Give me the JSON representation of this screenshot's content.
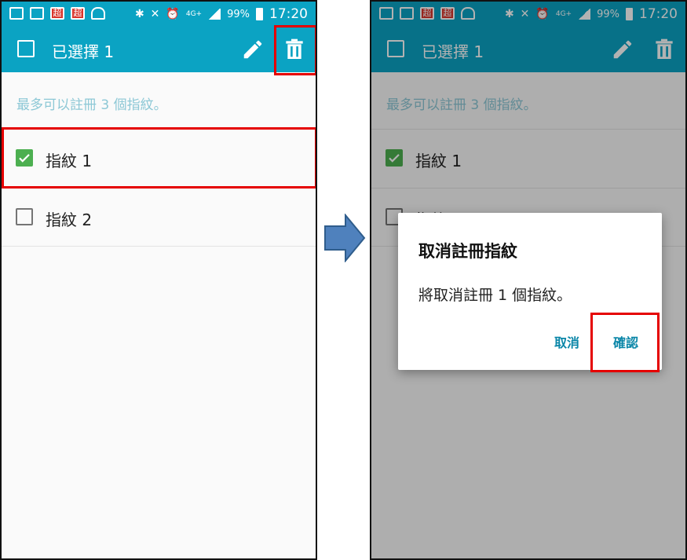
{
  "status_bar": {
    "battery": "99%",
    "time": "17:20",
    "network": "4G+",
    "app_icon_glyph": "超"
  },
  "selection": {
    "title": "已選擇 1"
  },
  "hint": "最多可以註冊 3 個指紋。",
  "fingerprints": [
    {
      "label": "指紋 1",
      "checked": true
    },
    {
      "label": "指紋 2",
      "checked": false
    }
  ],
  "dialog": {
    "title": "取消註冊指紋",
    "message": "將取消註冊 1 個指紋。",
    "cancel_label": "取消",
    "confirm_label": "確認"
  },
  "colors": {
    "accent": "#0ba3c3",
    "highlight": "#e50000",
    "check": "#4caf50",
    "arrow": "#4f81bd",
    "dialog_button": "#0a86a8"
  },
  "icons": {
    "edit": "pencil-icon",
    "delete": "trash-icon",
    "step": "arrow-right-icon"
  }
}
